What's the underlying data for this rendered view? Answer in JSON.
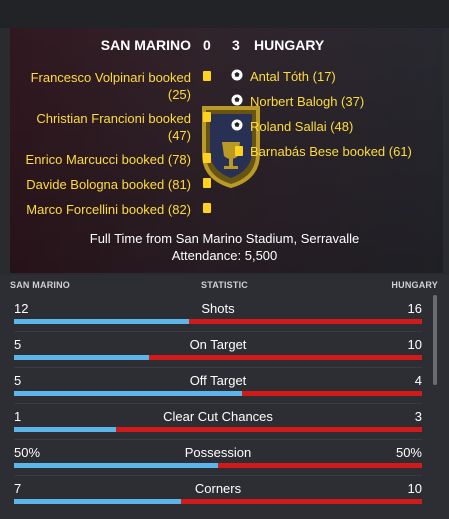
{
  "match": {
    "home_team": "SAN MARINO",
    "home_score": "0",
    "away_score": "3",
    "away_team": "HUNGARY"
  },
  "home_events": [
    {
      "text": "Francesco Volpinari booked",
      "minute": "(25)"
    },
    {
      "text": "Christian Francioni booked",
      "minute": "(47)"
    },
    {
      "text": "Enrico Marcucci booked (78)"
    },
    {
      "text": "Davide Bologna booked (81)"
    },
    {
      "text": "Marco Forcellini booked (82)"
    }
  ],
  "away_events": [
    {
      "text": "Antal Tóth (17)"
    },
    {
      "text": "Norbert Balogh (37)"
    },
    {
      "text": "Roland Sallai (48)"
    },
    {
      "text": "Barnabás Bese booked (61)"
    }
  ],
  "summary": {
    "full_time": "Full Time from San Marino Stadium, Serravalle",
    "attendance": "Attendance: 5,500"
  },
  "stats_header": {
    "home": "SAN MARINO",
    "statistic": "STATISTIC",
    "away": "HUNGARY"
  },
  "stats": [
    {
      "label": "Shots",
      "home": "12",
      "away": "16",
      "home_fraction": 0.43
    },
    {
      "label": "On Target",
      "home": "5",
      "away": "10",
      "home_fraction": 0.33
    },
    {
      "label": "Off Target",
      "home": "5",
      "away": "4",
      "home_fraction": 0.56
    },
    {
      "label": "Clear Cut Chances",
      "home": "1",
      "away": "3",
      "home_fraction": 0.25
    },
    {
      "label": "Possession",
      "home": "50%",
      "away": "50%",
      "home_fraction": 0.5
    },
    {
      "label": "Corners",
      "home": "7",
      "away": "10",
      "home_fraction": 0.41
    }
  ],
  "colors": {
    "home_bar": "#5cb6ea",
    "away_bar": "#d11b1b",
    "event_text": "#ffdc3c"
  },
  "icons": {
    "booking": "yellow-card-icon",
    "goal": "football-icon"
  }
}
